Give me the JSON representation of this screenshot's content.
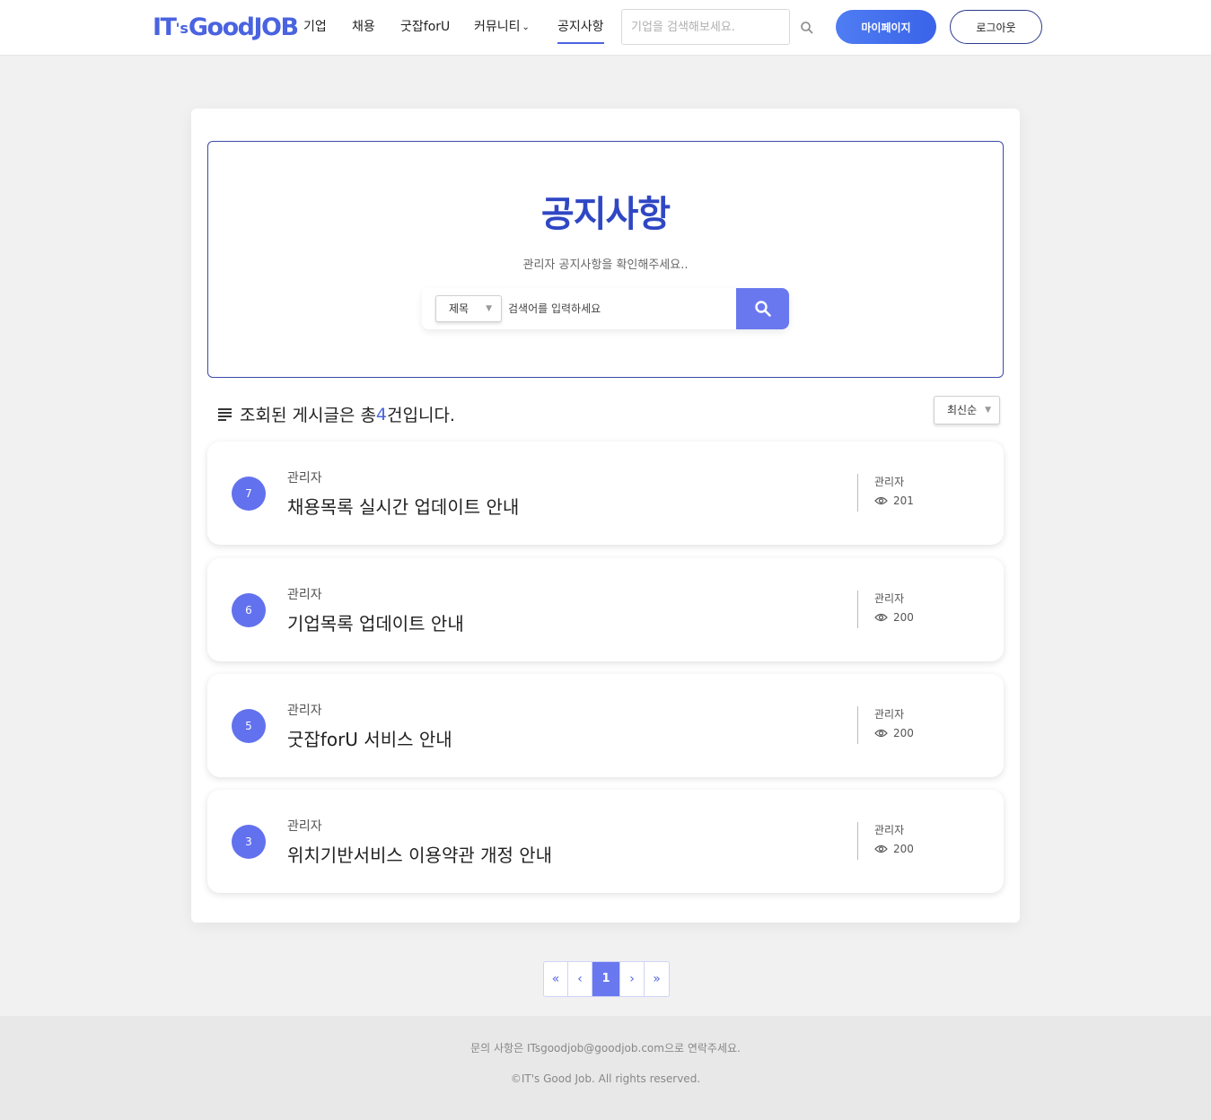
{
  "header": {
    "logo_text": "IT's GoodJOB",
    "logo_main": "IT",
    "logo_small": "'s",
    "logo_tail": "GoodJOB",
    "nav": [
      {
        "label": "기업"
      },
      {
        "label": "채용"
      },
      {
        "label": "굿잡forU"
      },
      {
        "label": "커뮤니티"
      },
      {
        "label": "공지사항",
        "active": true
      }
    ],
    "search_placeholder": "기업을 검색해보세요.",
    "mypage_label": "마이페이지",
    "logout_label": "로그아웃"
  },
  "hero": {
    "title": "공지사항",
    "subtitle": "관리자 공지사항을 확인해주세요..",
    "search_field_selected": "제목",
    "search_placeholder": "검색어를 입력하세요"
  },
  "results": {
    "prefix": "조회된 게시글은 총 ",
    "count": "4",
    "suffix": "건입니다.",
    "sort_selected": "최신순"
  },
  "posts": [
    {
      "num": "7",
      "author": "관리자",
      "title": "채용목록 실시간 업데이트 안내",
      "meta_author": "관리자",
      "views": "201"
    },
    {
      "num": "6",
      "author": "관리자",
      "title": "기업목록 업데이트 안내",
      "meta_author": "관리자",
      "views": "200"
    },
    {
      "num": "5",
      "author": "관리자",
      "title": "굿잡forU 서비스 안내",
      "meta_author": "관리자",
      "views": "200"
    },
    {
      "num": "3",
      "author": "관리자",
      "title": "위치기반서비스 이용약관 개정 안내",
      "meta_author": "관리자",
      "views": "200"
    }
  ],
  "pagination": {
    "first": "«",
    "prev": "‹",
    "current": "1",
    "next": "›",
    "last": "»"
  },
  "footer": {
    "contact": "문의 사항은 ITsgoodjob@goodjob.com으로 연락주세요.",
    "copyright": "©IT's Good Job. All rights reserved."
  },
  "colors": {
    "accent": "#4a63e0",
    "button_primary": "#6a78ef",
    "hero_title": "#2f47c4"
  },
  "icons": [
    "search-icon",
    "chevron-down-icon",
    "list-icon",
    "eye-icon"
  ]
}
